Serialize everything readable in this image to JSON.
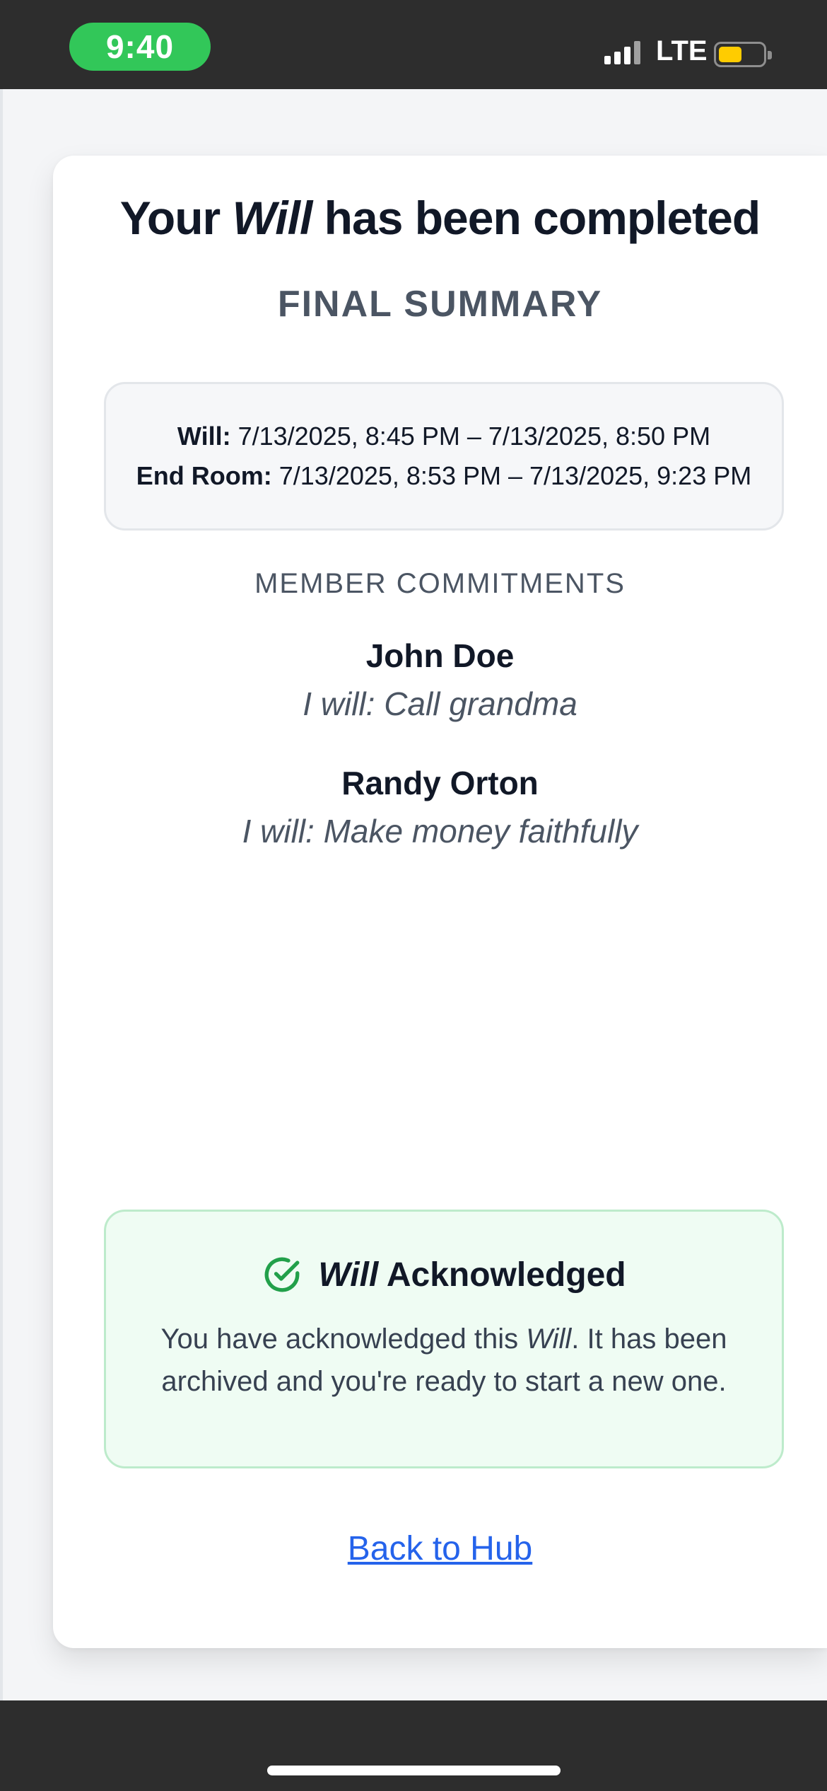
{
  "status_bar": {
    "time": "9:40",
    "network": "LTE",
    "icons": [
      "signal-icon",
      "battery-icon"
    ]
  },
  "header": {
    "title_prefix": "Your",
    "title_em": "Will",
    "title_suffix": "has been completed",
    "subtitle": "FINAL SUMMARY"
  },
  "timeframes": [
    {
      "label": "Will:",
      "value": "7/13/2025, 8:45 PM – 7/13/2025, 8:50 PM"
    },
    {
      "label": "End Room:",
      "value": "7/13/2025, 8:53 PM – 7/13/2025, 9:23 PM"
    }
  ],
  "commitments": {
    "section_label": "MEMBER COMMITMENTS",
    "members": [
      {
        "name": "John Doe",
        "commitment": "I will: Call grandma"
      },
      {
        "name": "Randy Orton",
        "commitment": "I will: Make money faithfully"
      }
    ]
  },
  "acknowledgement": {
    "icon": "check-circle-icon",
    "title_em": "Will",
    "title_rest": "Acknowledged",
    "body_prefix": "You have acknowledged this",
    "body_em": "Will",
    "body_suffix": ". It has been archived and you're ready to start a new one."
  },
  "footer": {
    "back_link": "Back to Hub"
  },
  "colors": {
    "accent_green": "#22a04a",
    "link_blue": "#2563eb",
    "status_time_pill": "#32c759",
    "battery_fill": "#ffcc00"
  }
}
